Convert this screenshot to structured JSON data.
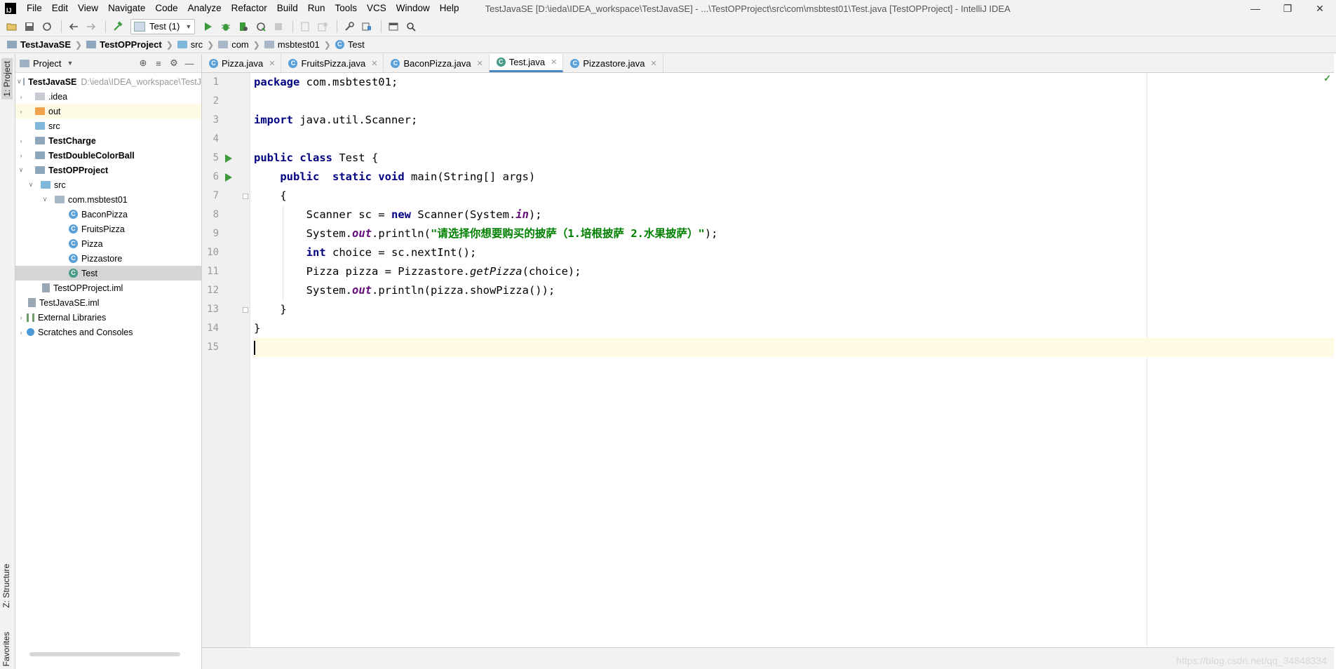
{
  "menubar": {
    "logo_text": "IJ",
    "items": [
      "File",
      "Edit",
      "View",
      "Navigate",
      "Code",
      "Analyze",
      "Refactor",
      "Build",
      "Run",
      "Tools",
      "VCS",
      "Window",
      "Help"
    ],
    "window_title": "TestJavaSE [D:\\ieda\\IDEA_workspace\\TestJavaSE] - ...\\TestOPProject\\src\\com\\msbtest01\\Test.java [TestOPProject] - IntelliJ IDEA"
  },
  "toolbar": {
    "run_config": "Test (1)",
    "icons": [
      "open-icon",
      "save-icon",
      "sync-icon",
      "back-icon",
      "forward-icon",
      "build-icon",
      "run-icon",
      "debug-icon",
      "coverage-icon",
      "profile-icon",
      "stop-icon",
      "project-structure-icon",
      "sdk-icon",
      "settings-icon",
      "structure-icon",
      "terminal-icon",
      "search-icon"
    ]
  },
  "navbar": {
    "crumbs": [
      "TestJavaSE",
      "TestOPProject",
      "src",
      "com",
      "msbtest01",
      "Test"
    ]
  },
  "left_strip": {
    "project_tab": "1: Project",
    "structure_tab": "Z: Structure",
    "favorites_tab": "Favorites"
  },
  "project": {
    "title": "Project",
    "root": {
      "label": "TestJavaSE",
      "path": "D:\\ieda\\IDEA_workspace\\TestJ"
    },
    "items": [
      {
        "label": "TestJavaSE",
        "path": "D:\\ieda\\IDEA_workspace\\TestJ"
      },
      {
        "label": ".idea"
      },
      {
        "label": "out"
      },
      {
        "label": "src"
      },
      {
        "label": "TestCharge"
      },
      {
        "label": "TestDoubleColorBall"
      },
      {
        "label": "TestOPProject"
      },
      {
        "label": "src"
      },
      {
        "label": "com.msbtest01"
      },
      {
        "label": "BaconPizza"
      },
      {
        "label": "FruitsPizza"
      },
      {
        "label": "Pizza"
      },
      {
        "label": "Pizzastore"
      },
      {
        "label": "Test"
      },
      {
        "label": "TestOPProject.iml"
      },
      {
        "label": "TestJavaSE.iml"
      },
      {
        "label": "External Libraries"
      },
      {
        "label": "Scratches and Consoles"
      }
    ]
  },
  "tabs": [
    {
      "label": "Pizza.java"
    },
    {
      "label": "FruitsPizza.java"
    },
    {
      "label": "BaconPizza.java"
    },
    {
      "label": "Test.java"
    },
    {
      "label": "Pizzastore.java"
    }
  ],
  "editor": {
    "line_numbers": [
      "1",
      "2",
      "3",
      "4",
      "5",
      "6",
      "7",
      "8",
      "9",
      "10",
      "11",
      "12",
      "13",
      "14",
      "15"
    ],
    "code": {
      "l1_kw": "package",
      "l1_rest": " com.msbtest01;",
      "l3_kw": "import",
      "l3_rest": " java.util.Scanner;",
      "l5_kw": "public class",
      "l5_rest": " Test {",
      "l6_kw1": "public",
      "l6_kw2": "static void",
      "l6_rest": " main(String[] args)",
      "l7": "{",
      "l8_a": "Scanner sc = ",
      "l8_kw": "new",
      "l8_b": " Scanner(System.",
      "l8_st": "in",
      "l8_c": ");",
      "l9_a": "System.",
      "l9_st": "out",
      "l9_b": ".println(",
      "l9_str": "\"请选择你想要购买的披萨（1.培根披萨 2.水果披萨）\"",
      "l9_c": ");",
      "l10_kw": "int",
      "l10_rest": " choice = sc.nextInt();",
      "l11_a": "Pizza pizza = Pizzastore.",
      "l11_it": "getPizza",
      "l11_b": "(choice);",
      "l12_a": "System.",
      "l12_st": "out",
      "l12_b": ".println(pizza.showPizza());",
      "l13": "}",
      "l14": "}"
    }
  },
  "watermark": "https://blog.csdn.net/qq_34848334"
}
